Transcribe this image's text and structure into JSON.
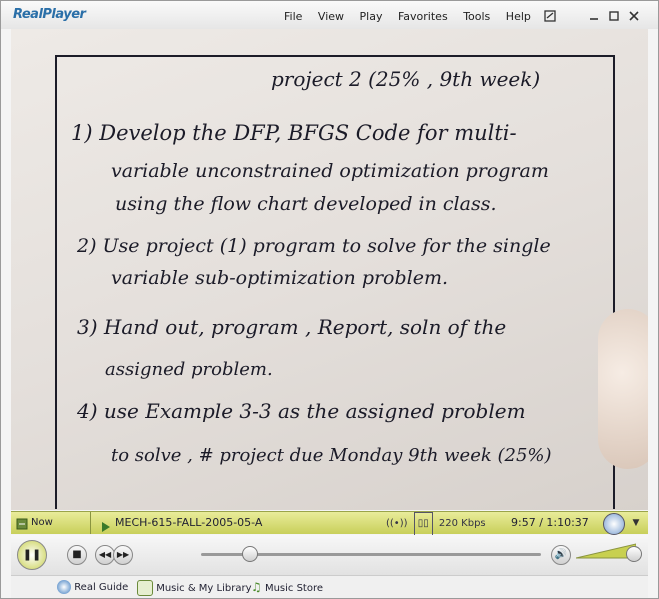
{
  "app": {
    "logo": "RealPlayer"
  },
  "menu": [
    "File",
    "View",
    "Play",
    "Favorites",
    "Tools",
    "Help"
  ],
  "video": {
    "lines": [
      "project 2  (25% , 9th week)",
      "1) Develop the DFP, BFGS Code for multi-",
      "variable unconstrained optimization program",
      "using the flow chart developed in class.",
      "2) Use project (1) program to solve for the single",
      "variable sub-optimization problem.",
      "3) Hand out, program , Report, soln of the",
      "assigned problem.",
      "4) use Example 3-3 as the assigned problem",
      "to solve ,  # project due Monday 9th week (25%)"
    ]
  },
  "status": {
    "now_playing": "Now Playing",
    "clip": "MECH-615-FALL-2005-05-A",
    "bitrate": "220 Kbps",
    "time": "9:57 / 1:10:37",
    "accent": "#c8d050"
  },
  "controls": {
    "progress_fraction": 0.14,
    "volume_fraction": 0.95
  },
  "bottom": {
    "guide": "Real Guide",
    "library": "Music & My Library",
    "store": "Music Store"
  }
}
